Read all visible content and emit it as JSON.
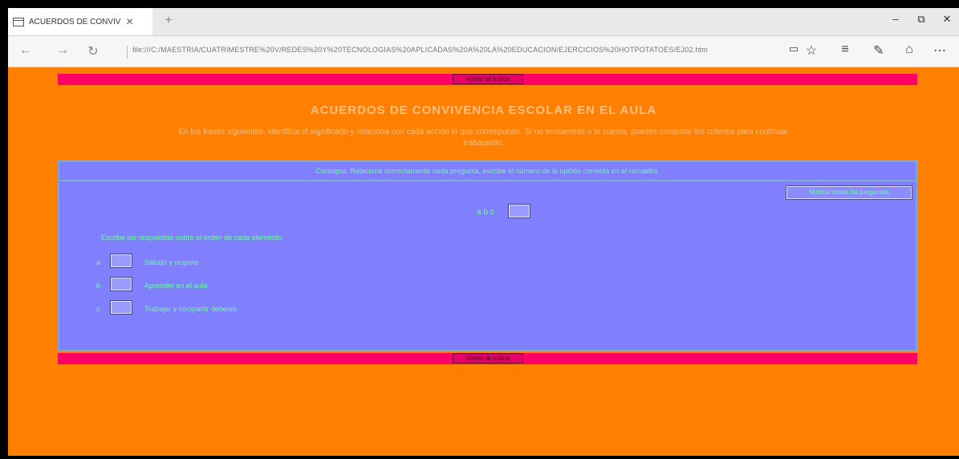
{
  "browser": {
    "tab_title": "ACUERDOS DE CONVIV",
    "tab_close": "✕",
    "new_tab": "+",
    "url": "file:///C:/MAESTRIA/CUATRIMESTRE%20V/REDES%20Y%20TECNOLOGIAS%20APLICADAS%20A%20LA%20EDUCACION/EJERCICIOS%20HOTPOTATOES/EJ02.htm",
    "minimize": "–",
    "maximize": "⧉",
    "close": "✕"
  },
  "page": {
    "back_button_top": "Volver al índice",
    "back_button_bottom": "Volver al índice",
    "title": "ACUERDOS DE CONVIVENCIA ESCOLAR EN EL AULA",
    "intro": "En los frases siguientes, identifica el significado y relaciona con cada acción lo que corresponde. Si no encuentras o te cuesta, puedes consultar los criterios para continuar",
    "intro_line2": "trabajando.",
    "panel_header": "Consigna: Relaciona correctamente cada pregunta, escribe el número de la opción correcta en el recuadro.",
    "solutions_button": "Mostrar todas las preguntas",
    "word_label": "a b c",
    "instruction": "Escribe las respuestas sobre el orden de cada elemento:",
    "options": [
      {
        "letter": "a",
        "text": "Saludo y respeto"
      },
      {
        "letter": "b",
        "text": "Aprender en el aula"
      },
      {
        "letter": "c",
        "text": "Trabajar y compartir deberes"
      }
    ]
  },
  "colors": {
    "page_bg": "#ff8000",
    "pink_bar": "#ff0066",
    "panel_bg": "#8080ff",
    "text_green": "#66ff99",
    "title_color": "#ffbf80"
  }
}
